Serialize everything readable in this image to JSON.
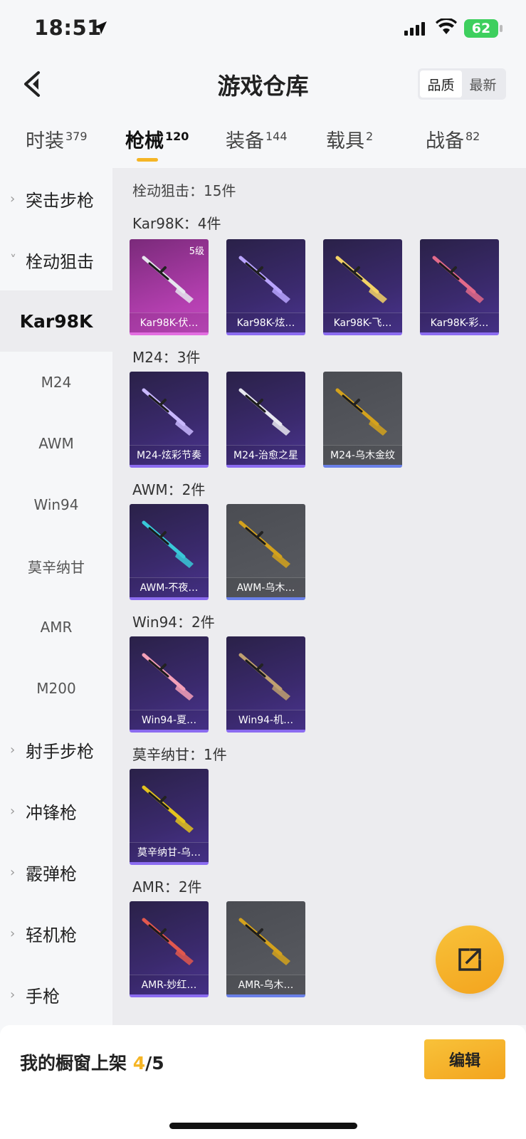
{
  "status_bar": {
    "time": "18:51",
    "battery": "62"
  },
  "header": {
    "title": "游戏仓库",
    "sort_options": [
      "品质",
      "最新"
    ],
    "sort_active": "品质"
  },
  "tabs": [
    {
      "label": "时装",
      "count": "379"
    },
    {
      "label": "枪械",
      "count": "120"
    },
    {
      "label": "装备",
      "count": "144"
    },
    {
      "label": "载具",
      "count": "2"
    },
    {
      "label": "战备",
      "count": "82"
    }
  ],
  "active_tab": "枪械",
  "sidebar": {
    "items": [
      {
        "label": "突击步枪",
        "type": "group",
        "expanded": false
      },
      {
        "label": "栓动狙击",
        "type": "group",
        "expanded": true
      },
      {
        "label": "Kar98K",
        "type": "sub",
        "active": true
      },
      {
        "label": "M24",
        "type": "sub"
      },
      {
        "label": "AWM",
        "type": "sub"
      },
      {
        "label": "Win94",
        "type": "sub"
      },
      {
        "label": "莫辛纳甘",
        "type": "sub"
      },
      {
        "label": "AMR",
        "type": "sub"
      },
      {
        "label": "M200",
        "type": "sub"
      },
      {
        "label": "射手步枪",
        "type": "group",
        "expanded": false
      },
      {
        "label": "冲锋枪",
        "type": "group",
        "expanded": false
      },
      {
        "label": "霰弹枪",
        "type": "group",
        "expanded": false
      },
      {
        "label": "轻机枪",
        "type": "group",
        "expanded": false
      },
      {
        "label": "手枪",
        "type": "group",
        "expanded": false
      }
    ]
  },
  "content": {
    "category_count": "栓动狙击：15件",
    "sections": [
      {
        "title": "Kar98K：4件",
        "items": [
          {
            "name": "Kar98K-伏…",
            "level": "5级",
            "rarity": "pink",
            "accent": "#e6e6ee"
          },
          {
            "name": "Kar98K-炫…",
            "rarity": "purple",
            "accent": "#b9a4ff"
          },
          {
            "name": "Kar98K-飞…",
            "rarity": "purple",
            "accent": "#f3d266"
          },
          {
            "name": "Kar98K-彩…",
            "rarity": "purple",
            "accent": "#e26a8a"
          }
        ]
      },
      {
        "title": "M24：3件",
        "items": [
          {
            "name": "M24-炫彩节奏",
            "rarity": "purple",
            "accent": "#c9b8ff"
          },
          {
            "name": "M24-治愈之星",
            "rarity": "purple",
            "accent": "#e8e8f0"
          },
          {
            "name": "M24-乌木金纹",
            "rarity": "gray",
            "accent": "#d4a21c"
          }
        ]
      },
      {
        "title": "AWM：2件",
        "items": [
          {
            "name": "AWM-不夜…",
            "rarity": "purple",
            "accent": "#38c9d8"
          },
          {
            "name": "AWM-乌木…",
            "rarity": "gray",
            "accent": "#d4a21c"
          }
        ]
      },
      {
        "title": "Win94：2件",
        "items": [
          {
            "name": "Win94-夏…",
            "rarity": "purple",
            "accent": "#f4a0b8"
          },
          {
            "name": "Win94-机…",
            "rarity": "purple",
            "accent": "#c0a070"
          }
        ]
      },
      {
        "title": "莫辛纳甘：1件",
        "items": [
          {
            "name": "莫辛纳甘-乌…",
            "rarity": "purple",
            "accent": "#e3c21e"
          }
        ]
      },
      {
        "title": "AMR：2件",
        "items": [
          {
            "name": "AMR-妙红…",
            "rarity": "purple",
            "accent": "#e2584e"
          },
          {
            "name": "AMR-乌木…",
            "rarity": "gray",
            "accent": "#d4a21c"
          }
        ]
      }
    ]
  },
  "footer": {
    "shelf_label": "我的橱窗上架",
    "shelf_current": "4",
    "shelf_total": "/5",
    "edit_label": "编辑"
  },
  "colors": {
    "accent": "#f5b525",
    "purple_card": "#3b2a6e",
    "pink_card": "#b43fb0",
    "gray_card": "#55575d"
  }
}
